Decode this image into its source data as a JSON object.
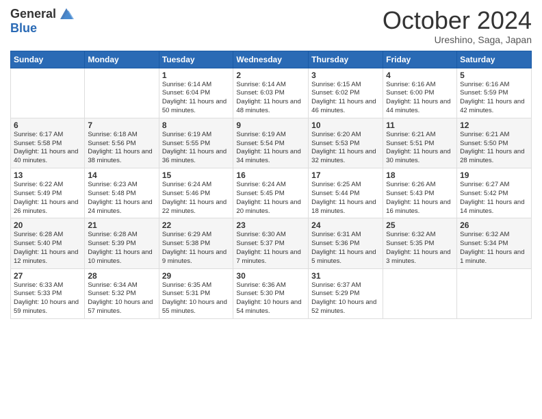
{
  "header": {
    "logo_general": "General",
    "logo_blue": "Blue",
    "month_title": "October 2024",
    "subtitle": "Ureshino, Saga, Japan"
  },
  "weekdays": [
    "Sunday",
    "Monday",
    "Tuesday",
    "Wednesday",
    "Thursday",
    "Friday",
    "Saturday"
  ],
  "weeks": [
    [
      {
        "day": "",
        "info": ""
      },
      {
        "day": "",
        "info": ""
      },
      {
        "day": "1",
        "info": "Sunrise: 6:14 AM\nSunset: 6:04 PM\nDaylight: 11 hours and 50 minutes."
      },
      {
        "day": "2",
        "info": "Sunrise: 6:14 AM\nSunset: 6:03 PM\nDaylight: 11 hours and 48 minutes."
      },
      {
        "day": "3",
        "info": "Sunrise: 6:15 AM\nSunset: 6:02 PM\nDaylight: 11 hours and 46 minutes."
      },
      {
        "day": "4",
        "info": "Sunrise: 6:16 AM\nSunset: 6:00 PM\nDaylight: 11 hours and 44 minutes."
      },
      {
        "day": "5",
        "info": "Sunrise: 6:16 AM\nSunset: 5:59 PM\nDaylight: 11 hours and 42 minutes."
      }
    ],
    [
      {
        "day": "6",
        "info": "Sunrise: 6:17 AM\nSunset: 5:58 PM\nDaylight: 11 hours and 40 minutes."
      },
      {
        "day": "7",
        "info": "Sunrise: 6:18 AM\nSunset: 5:56 PM\nDaylight: 11 hours and 38 minutes."
      },
      {
        "day": "8",
        "info": "Sunrise: 6:19 AM\nSunset: 5:55 PM\nDaylight: 11 hours and 36 minutes."
      },
      {
        "day": "9",
        "info": "Sunrise: 6:19 AM\nSunset: 5:54 PM\nDaylight: 11 hours and 34 minutes."
      },
      {
        "day": "10",
        "info": "Sunrise: 6:20 AM\nSunset: 5:53 PM\nDaylight: 11 hours and 32 minutes."
      },
      {
        "day": "11",
        "info": "Sunrise: 6:21 AM\nSunset: 5:51 PM\nDaylight: 11 hours and 30 minutes."
      },
      {
        "day": "12",
        "info": "Sunrise: 6:21 AM\nSunset: 5:50 PM\nDaylight: 11 hours and 28 minutes."
      }
    ],
    [
      {
        "day": "13",
        "info": "Sunrise: 6:22 AM\nSunset: 5:49 PM\nDaylight: 11 hours and 26 minutes."
      },
      {
        "day": "14",
        "info": "Sunrise: 6:23 AM\nSunset: 5:48 PM\nDaylight: 11 hours and 24 minutes."
      },
      {
        "day": "15",
        "info": "Sunrise: 6:24 AM\nSunset: 5:46 PM\nDaylight: 11 hours and 22 minutes."
      },
      {
        "day": "16",
        "info": "Sunrise: 6:24 AM\nSunset: 5:45 PM\nDaylight: 11 hours and 20 minutes."
      },
      {
        "day": "17",
        "info": "Sunrise: 6:25 AM\nSunset: 5:44 PM\nDaylight: 11 hours and 18 minutes."
      },
      {
        "day": "18",
        "info": "Sunrise: 6:26 AM\nSunset: 5:43 PM\nDaylight: 11 hours and 16 minutes."
      },
      {
        "day": "19",
        "info": "Sunrise: 6:27 AM\nSunset: 5:42 PM\nDaylight: 11 hours and 14 minutes."
      }
    ],
    [
      {
        "day": "20",
        "info": "Sunrise: 6:28 AM\nSunset: 5:40 PM\nDaylight: 11 hours and 12 minutes."
      },
      {
        "day": "21",
        "info": "Sunrise: 6:28 AM\nSunset: 5:39 PM\nDaylight: 11 hours and 10 minutes."
      },
      {
        "day": "22",
        "info": "Sunrise: 6:29 AM\nSunset: 5:38 PM\nDaylight: 11 hours and 9 minutes."
      },
      {
        "day": "23",
        "info": "Sunrise: 6:30 AM\nSunset: 5:37 PM\nDaylight: 11 hours and 7 minutes."
      },
      {
        "day": "24",
        "info": "Sunrise: 6:31 AM\nSunset: 5:36 PM\nDaylight: 11 hours and 5 minutes."
      },
      {
        "day": "25",
        "info": "Sunrise: 6:32 AM\nSunset: 5:35 PM\nDaylight: 11 hours and 3 minutes."
      },
      {
        "day": "26",
        "info": "Sunrise: 6:32 AM\nSunset: 5:34 PM\nDaylight: 11 hours and 1 minute."
      }
    ],
    [
      {
        "day": "27",
        "info": "Sunrise: 6:33 AM\nSunset: 5:33 PM\nDaylight: 10 hours and 59 minutes."
      },
      {
        "day": "28",
        "info": "Sunrise: 6:34 AM\nSunset: 5:32 PM\nDaylight: 10 hours and 57 minutes."
      },
      {
        "day": "29",
        "info": "Sunrise: 6:35 AM\nSunset: 5:31 PM\nDaylight: 10 hours and 55 minutes."
      },
      {
        "day": "30",
        "info": "Sunrise: 6:36 AM\nSunset: 5:30 PM\nDaylight: 10 hours and 54 minutes."
      },
      {
        "day": "31",
        "info": "Sunrise: 6:37 AM\nSunset: 5:29 PM\nDaylight: 10 hours and 52 minutes."
      },
      {
        "day": "",
        "info": ""
      },
      {
        "day": "",
        "info": ""
      }
    ]
  ]
}
